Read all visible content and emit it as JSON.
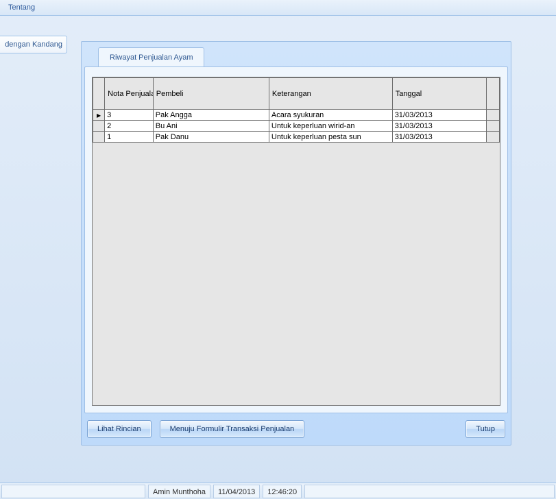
{
  "menu": {
    "tentang": "Tentang"
  },
  "left_tab": {
    "label": "dengan Kandang"
  },
  "tab": {
    "label": "Riwayat Penjualan Ayam"
  },
  "grid": {
    "headers": {
      "nota": "Nota Penjualan",
      "pembeli": "Pembeli",
      "keterangan": "Keterangan",
      "tanggal": "Tanggal"
    },
    "rows": [
      {
        "active": true,
        "nota": "3",
        "pembeli": "Pak Angga",
        "keterangan": "Acara syukuran",
        "tanggal": "31/03/2013"
      },
      {
        "active": false,
        "nota": "2",
        "pembeli": "Bu Ani",
        "keterangan": "Untuk keperluan wirid-an",
        "tanggal": "31/03/2013"
      },
      {
        "active": false,
        "nota": "1",
        "pembeli": "Pak Danu",
        "keterangan": "Untuk keperluan pesta sun",
        "tanggal": "31/03/2013"
      }
    ]
  },
  "buttons": {
    "lihat_rincian": "Lihat Rincian",
    "menuju_formulir": "Menuju Formulir Transaksi Penjualan",
    "tutup": "Tutup"
  },
  "status": {
    "user": "Amin Munthoha",
    "date": "11/04/2013",
    "time": "12:46:20"
  }
}
